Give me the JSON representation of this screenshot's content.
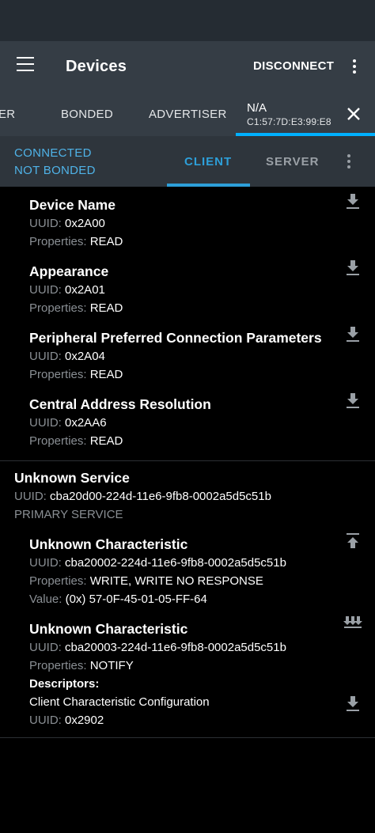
{
  "app_bar": {
    "title": "Devices",
    "disconnect_label": "DISCONNECT"
  },
  "device_tabs": {
    "partial_tab": "ER",
    "bonded_tab": "BONDED",
    "advertiser_tab": "ADVERTISER",
    "active_tab": {
      "name": "N/A",
      "address": "C1:57:7D:E3:99:E8"
    }
  },
  "connection": {
    "state": "CONNECTED",
    "bond_state": "NOT BONDED",
    "client_tab": "CLIENT",
    "server_tab": "SERVER"
  },
  "labels": {
    "uuid": "UUID: ",
    "properties": "Properties: ",
    "value": "Value: ",
    "descriptors": "Descriptors:"
  },
  "top_characteristics": [
    {
      "name": "Device Name",
      "uuid": "0x2A00",
      "properties": "READ",
      "icon": "download-icon"
    },
    {
      "name": "Appearance",
      "uuid": "0x2A01",
      "properties": "READ",
      "icon": "download-icon"
    },
    {
      "name": "Peripheral Preferred Connection Parameters",
      "uuid": "0x2A04",
      "properties": "READ",
      "icon": "download-icon"
    },
    {
      "name": "Central Address Resolution",
      "uuid": "0x2AA6",
      "properties": "READ",
      "icon": "download-icon"
    }
  ],
  "service": {
    "name": "Unknown Service",
    "uuid": "cba20d00-224d-11e6-9fb8-0002a5d5c51b",
    "type": "PRIMARY SERVICE",
    "characteristics": [
      {
        "name": "Unknown Characteristic",
        "uuid": "cba20002-224d-11e6-9fb8-0002a5d5c51b",
        "properties": "WRITE, WRITE NO RESPONSE",
        "value": "(0x) 57-0F-45-01-05-FF-64",
        "icon": "upload-icon"
      },
      {
        "name": "Unknown Characteristic",
        "uuid": "cba20003-224d-11e6-9fb8-0002a5d5c51b",
        "properties": "NOTIFY",
        "icon": "notify-multiple-download-icon",
        "descriptor": {
          "name": "Client Characteristic Configuration",
          "uuid": "0x2902",
          "icon": "download-icon"
        }
      }
    ]
  },
  "colors": {
    "status_bar": "#252c33",
    "app_bar": "#353d45",
    "sub_bar": "#2e353c",
    "accent": "#00b0ff",
    "connected_text": "#4fb3e8",
    "secondary_text": "#8a8f94"
  }
}
